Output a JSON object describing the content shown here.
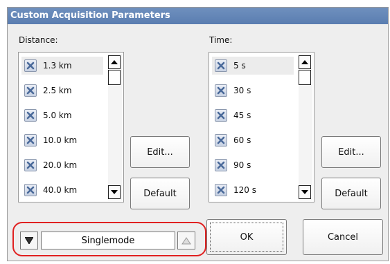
{
  "dialog": {
    "title": "Custom Acquisition Parameters"
  },
  "distance": {
    "label": "Distance:",
    "items": [
      {
        "label": "1.3 km",
        "checked": true
      },
      {
        "label": "2.5 km",
        "checked": true
      },
      {
        "label": "5.0 km",
        "checked": true
      },
      {
        "label": "10.0 km",
        "checked": true
      },
      {
        "label": "20.0 km",
        "checked": true
      },
      {
        "label": "40.0 km",
        "checked": true
      }
    ],
    "edit_label": "Edit...",
    "default_label": "Default"
  },
  "time": {
    "label": "Time:",
    "items": [
      {
        "label": "5 s",
        "checked": true
      },
      {
        "label": "30 s",
        "checked": true
      },
      {
        "label": "45 s",
        "checked": true
      },
      {
        "label": "60 s",
        "checked": true
      },
      {
        "label": "90 s",
        "checked": true
      },
      {
        "label": "120 s",
        "checked": true
      }
    ],
    "edit_label": "Edit...",
    "default_label": "Default"
  },
  "mode": {
    "value": "Singlemode"
  },
  "footer": {
    "ok_label": "OK",
    "cancel_label": "Cancel"
  },
  "colors": {
    "titlebar": "#5a7db0",
    "highlight": "#e02020",
    "check_mark": "#4a6a9a"
  },
  "icons": {
    "check": "x-check-icon",
    "scroll_up": "arrow-up-icon",
    "scroll_down": "arrow-down-icon",
    "mode_prev": "triangle-down-icon",
    "mode_next": "triangle-up-icon"
  }
}
